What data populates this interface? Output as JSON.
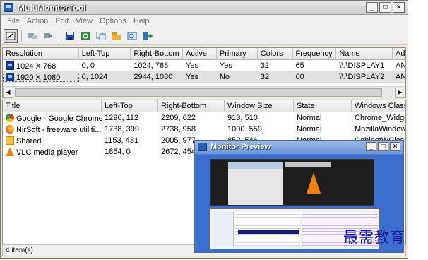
{
  "window": {
    "title": "MultiMonitorTool",
    "controls": {
      "minimize": "_",
      "maximize": "□",
      "close": "×"
    }
  },
  "menu": [
    "File",
    "Action",
    "Edit",
    "View",
    "Options",
    "Help"
  ],
  "toolbar": {
    "buttons": [
      "select-tool-icon",
      "disable-icon",
      "enable-icon",
      "save-icon",
      "refresh-icon",
      "copy-icon",
      "properties-icon",
      "preview-icon",
      "exit-icon"
    ]
  },
  "monitors": {
    "columns": [
      "Resolution",
      "Left-Top",
      "Right-Bottom",
      "Active",
      "Primary",
      "Colors",
      "Frequency",
      "Name",
      "Ad"
    ],
    "rows": [
      {
        "resolution": "1024 X 768",
        "left_top": "0, 0",
        "right_bottom": "1024, 768",
        "active": "Yes",
        "primary": "Yes",
        "colors": "32",
        "frequency": "65",
        "name": "\\\\.\\DISPLAY1",
        "ad": "AN"
      },
      {
        "resolution": "1920 X 1080",
        "left_top": "0, 1024",
        "right_bottom": "2944, 1080",
        "active": "Yes",
        "primary": "No",
        "colors": "32",
        "frequency": "60",
        "name": "\\\\.\\DISPLAY2",
        "ad": "AN"
      }
    ]
  },
  "windows": {
    "columns": [
      "Title",
      "Left-Top",
      "Right-Bottom",
      "Window Size",
      "State",
      "Windows Class"
    ],
    "rows": [
      {
        "icon": "chrome-icon",
        "title": "Google - Google Chrome",
        "left_top": "1296, 112",
        "right_bottom": "2209, 622",
        "size": "913, 510",
        "state": "Normal",
        "class": "Chrome_Widget"
      },
      {
        "icon": "firefox-icon",
        "title": "NirSoft - freeware utiliti...",
        "left_top": "1738, 399",
        "right_bottom": "2738, 958",
        "size": "1000, 559",
        "state": "Normal",
        "class": "MozillaWindowC"
      },
      {
        "icon": "folder-icon",
        "title": "Shared",
        "left_top": "1153, 431",
        "right_bottom": "2005, 977",
        "size": "852, 546",
        "state": "Normal",
        "class": "CabinetWClass"
      },
      {
        "icon": "vlc-icon",
        "title": "VLC media player",
        "left_top": "1864, 0",
        "right_bottom": "2672, 454",
        "size": "",
        "state": "",
        "class": ""
      }
    ]
  },
  "status": "4 item(s)",
  "preview": {
    "title": "Monitor Preview",
    "controls": {
      "minimize": "_",
      "maximize": "□",
      "close": "×"
    }
  },
  "watermark": "最需教育"
}
